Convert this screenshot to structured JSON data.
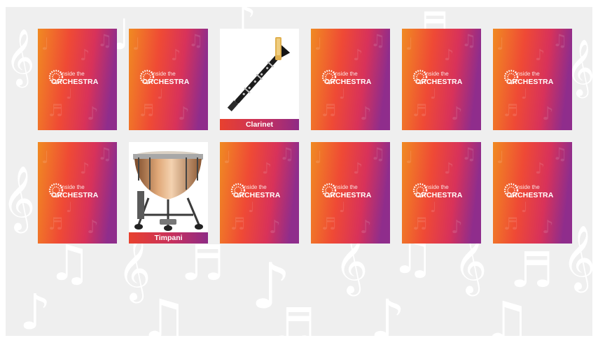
{
  "brand": {
    "logo_small": "Inside the",
    "logo_big": "ORCHESTRA"
  },
  "colors": {
    "card_gradient": [
      "#f08a22",
      "#ef4a35",
      "#d8325a",
      "#8f2d8c"
    ],
    "board_bg": "#efefef",
    "label_gradient": [
      "#e8412e",
      "#8e2b85"
    ]
  },
  "cards": [
    {
      "row": 0,
      "col": 0,
      "state": "face-down"
    },
    {
      "row": 0,
      "col": 1,
      "state": "face-down"
    },
    {
      "row": 0,
      "col": 2,
      "state": "face-up",
      "instrument": "clarinet-icon",
      "label": "Clarinet"
    },
    {
      "row": 0,
      "col": 3,
      "state": "face-down"
    },
    {
      "row": 0,
      "col": 4,
      "state": "face-down"
    },
    {
      "row": 0,
      "col": 5,
      "state": "face-down"
    },
    {
      "row": 1,
      "col": 0,
      "state": "face-down"
    },
    {
      "row": 1,
      "col": 1,
      "state": "face-up",
      "instrument": "timpani-icon",
      "label": "Timpani"
    },
    {
      "row": 1,
      "col": 2,
      "state": "face-down"
    },
    {
      "row": 1,
      "col": 3,
      "state": "face-down"
    },
    {
      "row": 1,
      "col": 4,
      "state": "face-down"
    },
    {
      "row": 1,
      "col": 5,
      "state": "face-down"
    }
  ]
}
